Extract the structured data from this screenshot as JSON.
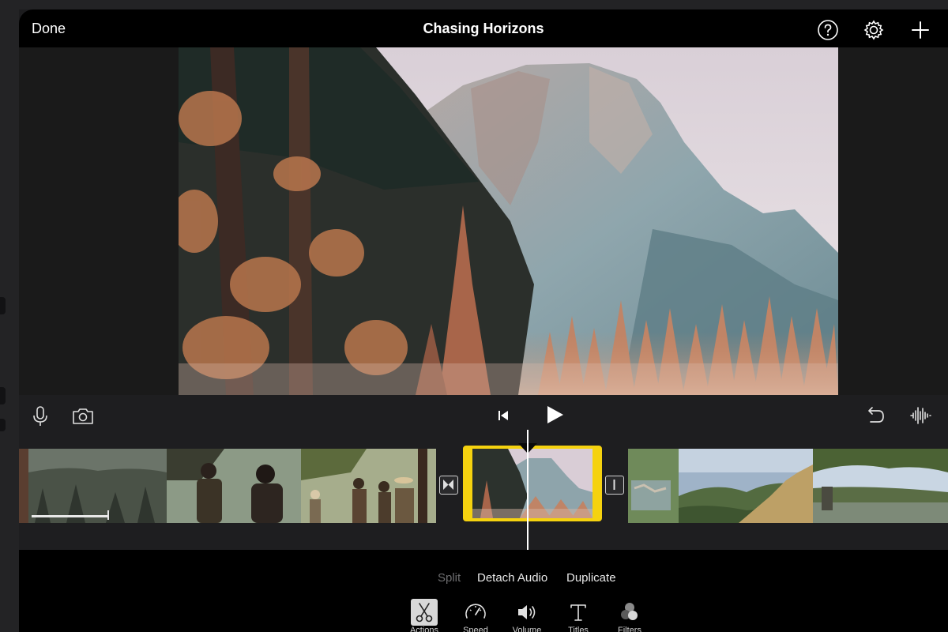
{
  "header": {
    "done_label": "Done",
    "title": "Chasing Horizons",
    "icons": [
      "help-icon",
      "settings-icon",
      "add-icon"
    ]
  },
  "toolbar": {
    "left_icons": [
      "microphone-icon",
      "camera-icon"
    ],
    "center_icons": [
      "skip-to-start-icon",
      "play-icon"
    ],
    "right_icons": [
      "undo-icon",
      "audio-waveform-icon"
    ]
  },
  "actions": {
    "split_label": "Split",
    "detach_audio_label": "Detach Audio",
    "duplicate_label": "Duplicate"
  },
  "tabs": [
    {
      "label": "Actions",
      "icon": "scissors-icon",
      "active": true
    },
    {
      "label": "Speed",
      "icon": "speedometer-icon",
      "active": false
    },
    {
      "label": "Volume",
      "icon": "speaker-icon",
      "active": false
    },
    {
      "label": "Titles",
      "icon": "text-icon",
      "active": false
    },
    {
      "label": "Filters",
      "icon": "filters-icon",
      "active": false
    }
  ],
  "colors": {
    "selection": "#f5d20f",
    "background": "#000000",
    "panel": "#1e1e20"
  }
}
